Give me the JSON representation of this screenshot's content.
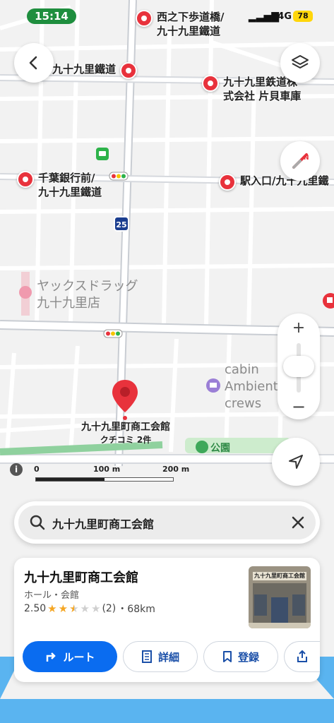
{
  "status_bar": {
    "time": "15:14",
    "network": "4G",
    "battery": "78"
  },
  "map": {
    "pois": [
      {
        "label_line1": "西之下歩道橋/",
        "label_line2": "九十九里鐵道"
      },
      {
        "label_line1": "九十九里鐵道",
        "label_line2": ""
      },
      {
        "label_line1": "九十九里鉄道株",
        "label_line2": "式会社 片貝車庫"
      },
      {
        "label_line1": "千葉銀行前/",
        "label_line2": "九十九里鐵道"
      },
      {
        "label_line1": "駅入口/九十九里鐵",
        "label_line2": ""
      }
    ],
    "route_shield": "25",
    "gray_pois": [
      {
        "label_line1": "ヤックスドラッグ",
        "label_line2": "九十九里店"
      },
      {
        "label_line1": "cabin",
        "label_line2": "Ambient",
        "label_line3": "crews"
      }
    ],
    "park_label": "公園",
    "selected_place": {
      "name": "九十九里町商工会館",
      "subtitle": "クチコミ 2件"
    },
    "scale": {
      "zero": "0",
      "mid": "100 m",
      "end": "200 m"
    },
    "zoom": {
      "plus": "+",
      "minus": "−"
    }
  },
  "search": {
    "query": "九十九里町商工会館"
  },
  "place_card": {
    "name": "九十九里町商工会館",
    "category": "ホール・会館",
    "rating": "2.50",
    "rating_value": 2.5,
    "review_count": "(2)",
    "distance": "・68km",
    "photo_sign": "九十九里町商工会館",
    "buttons": {
      "route": "ルート",
      "details": "詳細",
      "save": "登録"
    }
  },
  "colors": {
    "accent": "#0a6cf0",
    "pin": "#e8323c",
    "park": "#8fd19e",
    "sea": "#5ab4f0"
  }
}
